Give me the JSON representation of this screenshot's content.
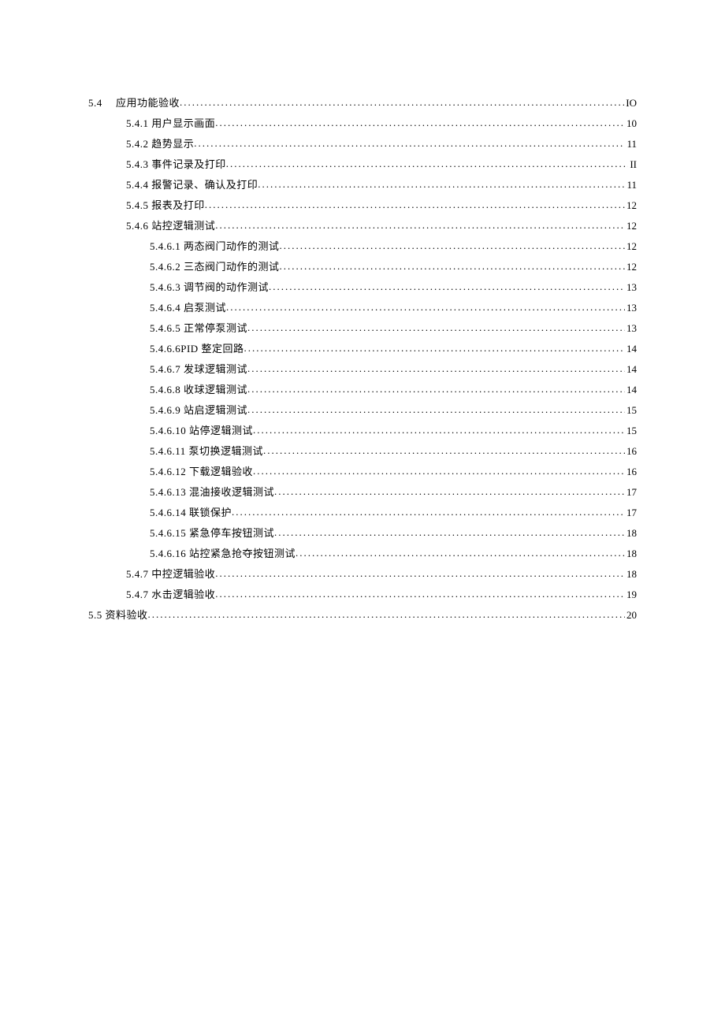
{
  "toc": [
    {
      "indent": 0,
      "label": "5.4　 应用功能验收",
      "page": "IO",
      "extraClass": "sec5-4"
    },
    {
      "indent": 1,
      "label": "5.4.1 用户显示画面",
      "page": "10"
    },
    {
      "indent": 1,
      "label": "5.4.2 趋势显示",
      "page": "11"
    },
    {
      "indent": 1,
      "label": "5.4.3 事件记录及打印",
      "page": "II"
    },
    {
      "indent": 1,
      "label": "5.4.4 报警记录、确认及打印",
      "page": "11"
    },
    {
      "indent": 1,
      "label": "5.4.5 报表及打印",
      "page": "12"
    },
    {
      "indent": 1,
      "label": "5.4.6 站控逻辑测试",
      "page": "12"
    },
    {
      "indent": 2,
      "label": "5.4.6.1 两态阀门动作的测试",
      "page": "12"
    },
    {
      "indent": 2,
      "label": "5.4.6.2 三态阀门动作的测试",
      "page": "12"
    },
    {
      "indent": 2,
      "label": "5.4.6.3 调节阀的动作测试",
      "page": "13"
    },
    {
      "indent": 2,
      "label": "5.4.6.4 启泵测试",
      "page": "13"
    },
    {
      "indent": 2,
      "label": "5.4.6.5 正常停泵测试",
      "page": "13"
    },
    {
      "indent": 2,
      "label": "5.4.6.6PID 整定回路",
      "page": "14"
    },
    {
      "indent": 2,
      "label": "5.4.6.7 发球逻辑测试",
      "page": "14"
    },
    {
      "indent": 2,
      "label": "5.4.6.8 收球逻辑测试",
      "page": "14"
    },
    {
      "indent": 2,
      "label": "5.4.6.9 站启逻辑测试",
      "page": "15"
    },
    {
      "indent": 2,
      "label": "5.4.6.10 站停逻辑测试",
      "page": "15"
    },
    {
      "indent": 2,
      "label": "5.4.6.11 泵切换逻辑测试",
      "page": "16"
    },
    {
      "indent": 2,
      "label": "5.4.6.12 下载逻辑验收",
      "page": "16"
    },
    {
      "indent": 2,
      "label": "5.4.6.13 混油接收逻辑测试",
      "page": "17"
    },
    {
      "indent": 2,
      "label": "5.4.6.14 联锁保护",
      "page": "17"
    },
    {
      "indent": 2,
      "label": "5.4.6.15 紧急停车按钮测试",
      "page": "18"
    },
    {
      "indent": 2,
      "label": "5.4.6.16 站控紧急抢夺按钮测试",
      "page": "18"
    },
    {
      "indent": 1,
      "label": "5.4.7 中控逻辑验收",
      "page": "18"
    },
    {
      "indent": 1,
      "label": "5.4.7 水击逻辑验收",
      "page": "19"
    },
    {
      "indent": 0,
      "label": "5.5 资料验收",
      "page": "20"
    }
  ]
}
